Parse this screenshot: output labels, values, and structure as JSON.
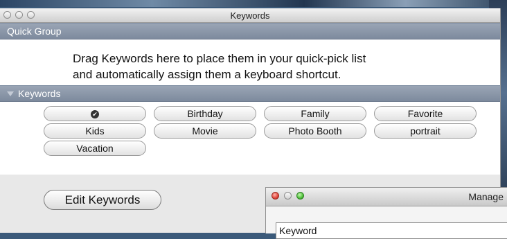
{
  "window": {
    "title": "Keywords"
  },
  "quick_group": {
    "header": "Quick Group",
    "instructions_line1": "Drag Keywords here to place them in your quick-pick list",
    "instructions_line2": "and automatically assign them a keyboard shortcut."
  },
  "keywords": {
    "header": "Keywords",
    "items": [
      {
        "label": "✔",
        "icon": "checkmark-icon"
      },
      {
        "label": "Birthday"
      },
      {
        "label": "Family"
      },
      {
        "label": "Favorite"
      },
      {
        "label": "Kids"
      },
      {
        "label": "Movie"
      },
      {
        "label": "Photo Booth"
      },
      {
        "label": "portrait"
      },
      {
        "label": "Vacation"
      }
    ]
  },
  "footer": {
    "edit_button": "Edit Keywords"
  },
  "manage_window": {
    "title": "Manage",
    "field_text": "Keyword"
  }
}
